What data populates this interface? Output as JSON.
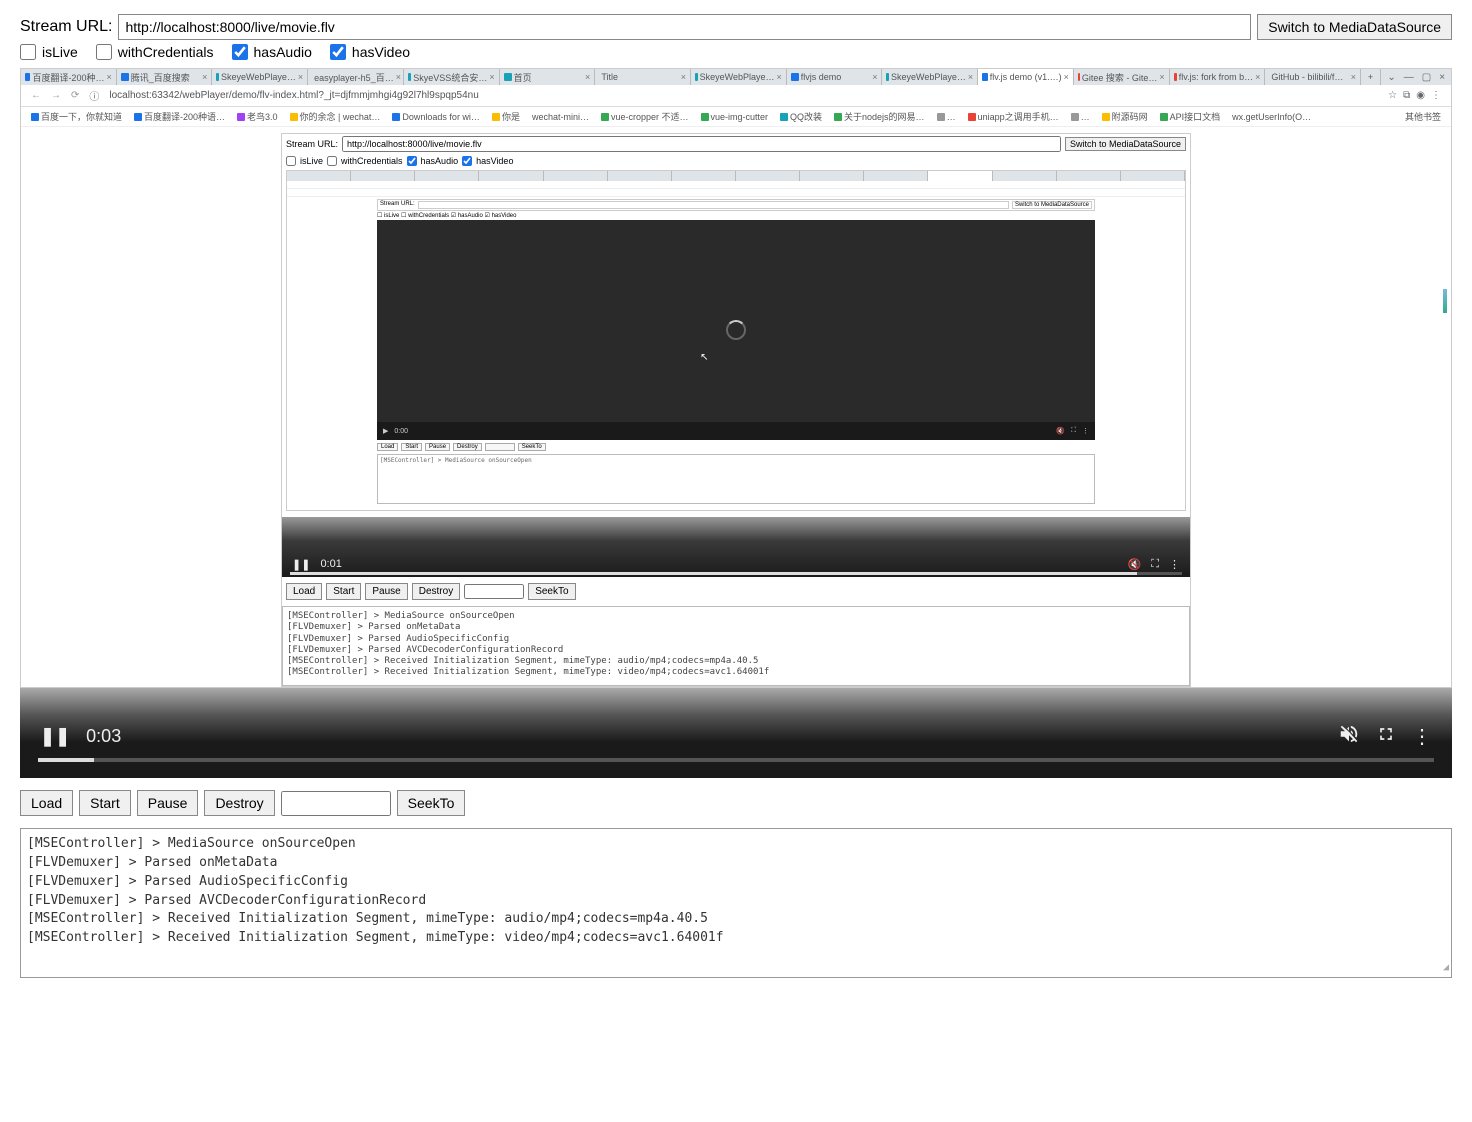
{
  "header": {
    "stream_label": "Stream URL:",
    "stream_value": "http://localhost:8000/live/movie.flv",
    "switch_btn": "Switch to MediaDataSource"
  },
  "checkboxes": {
    "isLive": {
      "label": "isLive",
      "checked": false
    },
    "withCredentials": {
      "label": "withCredentials",
      "checked": false
    },
    "hasAudio": {
      "label": "hasAudio",
      "checked": true
    },
    "hasVideo": {
      "label": "hasVideo",
      "checked": true
    }
  },
  "browser": {
    "tabs": [
      "百度翻译-200种…",
      "腾讯_百度搜索",
      "SkeyeWebPlaye…",
      "easyplayer-h5_百…",
      "SkyeVSS统合安…",
      "首页",
      "Title",
      "SkeyeWebPlaye…",
      "flvjs demo",
      "SkeyeWebPlaye…",
      "flv.js demo (v1.…)",
      "Gitee 搜索 - Gite…",
      "flv.js: fork from b…",
      "GitHub - bilibili/f…"
    ],
    "addr": "localhost:63342/webPlayer/demo/flv-index.html?_jt=djfmmjmhgi4g92l7hl9spqp54nu",
    "bookmarks": [
      "百度一下，你就知道",
      "百度翻译-200种语…",
      "老鸟3.0",
      "你的余念 | wechat…",
      "Downloads for wi…",
      "你是",
      "wechat-mini…",
      "vue-cropper 不适…",
      "vue-img-cutter",
      "QQ改装",
      "关于nodejs的网易…",
      "uniapp之调用手机…",
      "附源码网",
      "API接口文档",
      "wx.getUserInfo(O…"
    ],
    "bookmarks_other": "其他书签"
  },
  "inner": {
    "stream_label": "Stream URL:",
    "stream_value": "http://localhost:8000/live/movie.flv",
    "switch_btn": "Switch to MediaDataSource",
    "cb": {
      "isLive": "isLive",
      "withCredentials": "withCredentials",
      "hasAudio": "hasAudio",
      "hasVideo": "hasVideo"
    },
    "mini_time": "0:00",
    "mini_ctrls": [
      "Load",
      "Start",
      "Pause",
      "Destroy",
      "SeekTo"
    ],
    "mini_log": "[MSEController] > MediaSource onSourceOpen",
    "player_time": "0:01",
    "ctrls": {
      "load": "Load",
      "start": "Start",
      "pause": "Pause",
      "destroy": "Destroy",
      "seek": "SeekTo"
    },
    "log": [
      "[MSEController] > MediaSource onSourceOpen",
      "[FLVDemuxer] > Parsed onMetaData",
      "[FLVDemuxer] > Parsed AudioSpecificConfig",
      "[FLVDemuxer] > Parsed AVCDecoderConfigurationRecord",
      "[MSEController] > Received Initialization Segment, mimeType: audio/mp4;codecs=mp4a.40.5",
      "[MSEController] > Received Initialization Segment, mimeType: video/mp4;codecs=avc1.64001f"
    ]
  },
  "outer_player": {
    "time": "0:03"
  },
  "outer": {
    "ctrls": {
      "load": "Load",
      "start": "Start",
      "pause": "Pause",
      "destroy": "Destroy",
      "seek": "SeekTo"
    },
    "log": [
      "[MSEController] > MediaSource onSourceOpen",
      "[FLVDemuxer] > Parsed onMetaData",
      "[FLVDemuxer] > Parsed AudioSpecificConfig",
      "[FLVDemuxer] > Parsed AVCDecoderConfigurationRecord",
      "[MSEController] > Received Initialization Segment, mimeType: audio/mp4;codecs=mp4a.40.5",
      "[MSEController] > Received Initialization Segment, mimeType: video/mp4;codecs=avc1.64001f"
    ]
  }
}
